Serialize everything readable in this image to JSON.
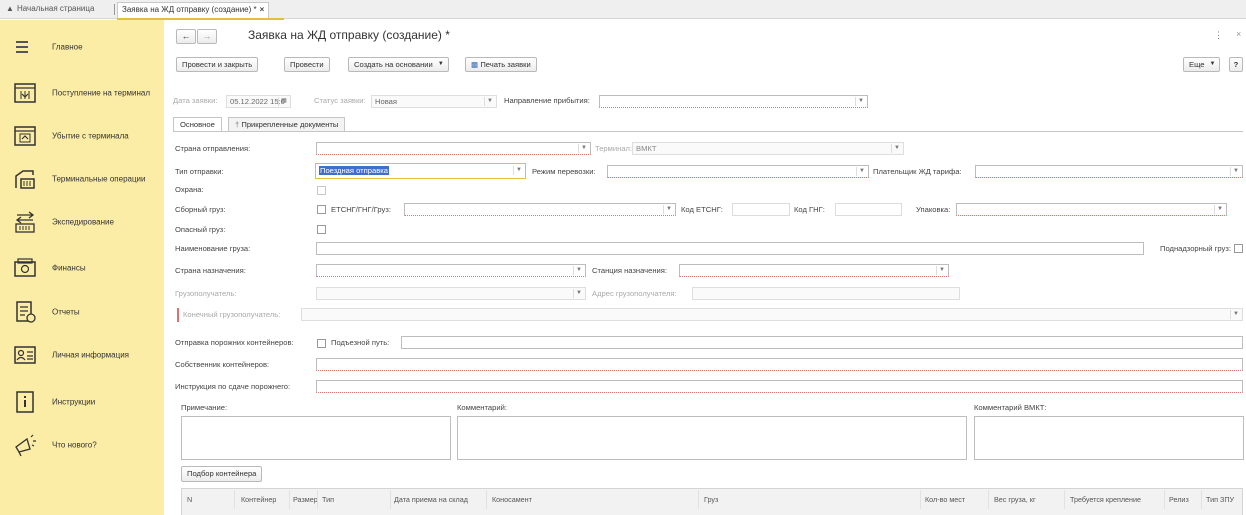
{
  "tabs": {
    "home": "Начальная страница",
    "active": "Заявка на ЖД отправку (создание) *",
    "close": "×"
  },
  "sidebar": {
    "items": [
      {
        "label": "Главное",
        "icon": "menu-icon"
      },
      {
        "label": "Поступление на терминал",
        "icon": "container-in-icon"
      },
      {
        "label": "Убытие с терминала",
        "icon": "container-out-icon"
      },
      {
        "label": "Терминальные операции",
        "icon": "crane-icon"
      },
      {
        "label": "Экспедирование",
        "icon": "transfer-icon"
      },
      {
        "label": "Финансы",
        "icon": "money-icon"
      },
      {
        "label": "Отчеты",
        "icon": "reports-icon"
      },
      {
        "label": "Личная информация",
        "icon": "id-card-icon"
      },
      {
        "label": "Инструкции",
        "icon": "info-icon"
      },
      {
        "label": "Что нового?",
        "icon": "megaphone-icon"
      }
    ]
  },
  "header": {
    "title": "Заявка на ЖД отправку (создание) *",
    "more": "⋮",
    "close": "×"
  },
  "toolbar": {
    "post_close": "Провести и закрыть",
    "post": "Провести",
    "create_based": "Создать на основании",
    "print": "Печать заявки",
    "more": "Еще",
    "help": "?"
  },
  "form": {
    "date_label": "Дата заявки:",
    "date_value": "05.12.2022 15:0",
    "status_label": "Статус заявки:",
    "status_value": "Новая",
    "direction_label": "Направление прибытия:",
    "direction_value": "",
    "tab_main": "Основное",
    "tab_docs": "Прикрепленные документы",
    "country_from_label": "Страна отправления:",
    "terminal_label": "Терминал:",
    "terminal_value": "ВМКТ",
    "dispatch_type_label": "Тип отправки:",
    "dispatch_type_value": "Поездная отправка",
    "transport_mode_label": "Режим перевозки:",
    "payer_label": "Плательщик ЖД тарифа:",
    "guard_label": "Охрана:",
    "consolidated_label": "Сборный груз:",
    "etsng_label": "ЕТСНГ/ГНГ/Груз:",
    "etsng_code_label": "Код ЕТСНГ:",
    "gng_code_label": "Код ГНГ:",
    "packing_label": "Упаковка:",
    "dangerous_label": "Опасный груз:",
    "cargo_name_label": "Наименование груза:",
    "supervised_label": "Поднадзорный груз:",
    "dest_country_label": "Страна назначения:",
    "dest_station_label": "Станция назначения:",
    "consignee_label": "Грузополучатель:",
    "consignee_addr_label": "Адрес грузополучателя:",
    "final_consignee_label": "Конечный грузополучатель:",
    "empty_containers_label": "Отправка порожних контейнеров:",
    "siding_label": "Подъезной путь:",
    "owner_label": "Собственник контейнеров:",
    "instruction_label": "Инструкция по сдаче порожнего:",
    "note_label": "Примечание:",
    "comment_label": "Комментарий:",
    "comment_vmkt_label": "Комментарий ВМКТ:",
    "pick_container": "Подбор контейнера"
  },
  "table": {
    "columns": [
      "N",
      "Контейнер",
      "Размер",
      "Тип",
      "Дата приема на склад",
      "Коносамент",
      "Груз",
      "Кол-во мест",
      "Вес груза, кг",
      "Требуется крепление",
      "Релиз",
      "Тип ЗПУ"
    ]
  },
  "colors": {
    "sidebar_bg": "#fbeca6",
    "accent": "#e4be3e",
    "required": "#e07070"
  }
}
